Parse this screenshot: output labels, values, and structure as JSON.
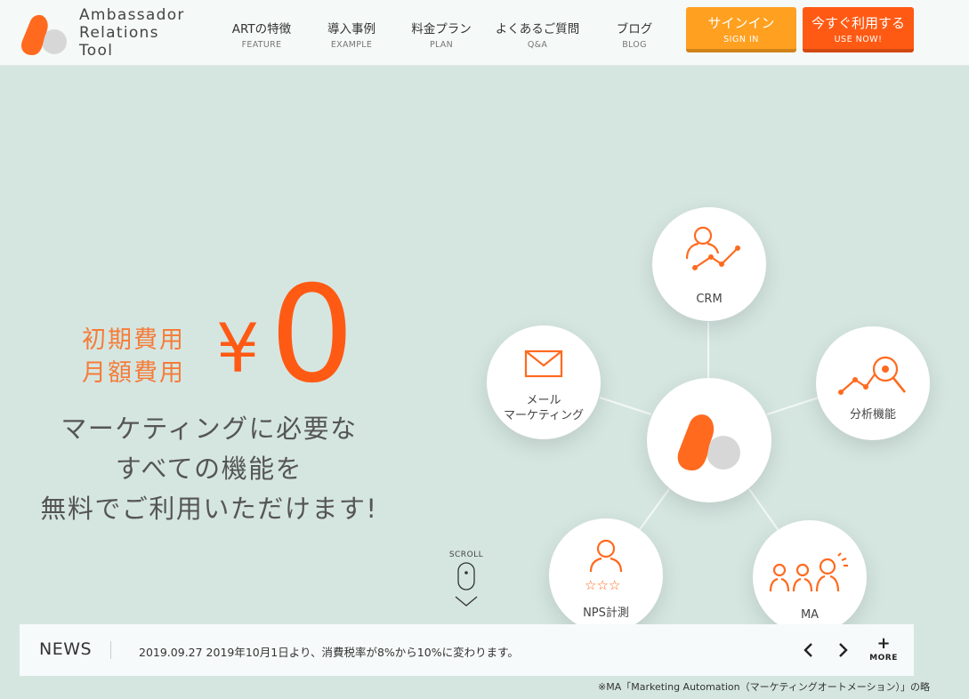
{
  "brand": {
    "name_line1": "Ambassador",
    "name_line2": "Relations",
    "name_line3": "Tool",
    "accent": "#ff5a14",
    "accent_light": "#ffa020",
    "background": "#d5e6e1"
  },
  "nav": {
    "items": [
      {
        "jp": "ARTの特徴",
        "en": "FEATURE"
      },
      {
        "jp": "導入事例",
        "en": "EXAMPLE"
      },
      {
        "jp": "料金プラン",
        "en": "PLAN"
      },
      {
        "jp": "よくあるご質問",
        "en": "Q&A"
      },
      {
        "jp": "ブログ",
        "en": "BLOG"
      }
    ],
    "signin": {
      "jp": "サインイン",
      "en": "SIGN IN"
    },
    "usenow": {
      "jp": "今すぐ利用する",
      "en": "USE NOW!"
    }
  },
  "hero": {
    "label_initial": "初期費用",
    "label_monthly": "月額費用",
    "yen": "¥",
    "price": "0",
    "tagline_line1": "マーケティングに必要な",
    "tagline_line2": "すべての機能を",
    "tagline_line3": "無料でご利用いただけます!"
  },
  "diagram": {
    "crm": "CRM",
    "mail_line1": "メール",
    "mail_line2": "マーケティング",
    "analytics": "分析機能",
    "nps": "NPS計測",
    "ma": "MA"
  },
  "scroll": {
    "label": "SCROLL"
  },
  "news": {
    "title": "NEWS",
    "item": "2019.09.27 2019年10月1日より、消費税率が8%から10%に変わります。",
    "more": "MORE"
  },
  "footnote": "※MA「Marketing Automation（マーケティングオートメーション）」の略"
}
